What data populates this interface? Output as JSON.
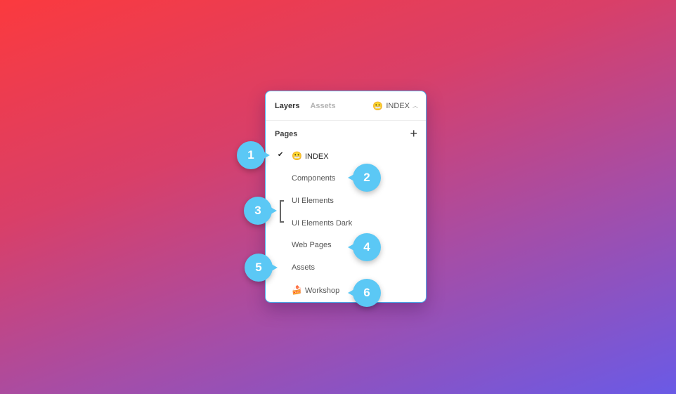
{
  "panel": {
    "tabs": [
      {
        "label": "Layers",
        "active": true
      },
      {
        "label": "Assets",
        "active": false
      }
    ],
    "current_page": {
      "emoji": "😬",
      "label": "INDEX"
    },
    "pages_header": "Pages",
    "add_icon": "plus-icon",
    "pages": [
      {
        "emoji": "😬",
        "label": "INDEX",
        "selected": true
      },
      {
        "emoji": "",
        "label": "Components"
      },
      {
        "emoji": "",
        "label": "UI Elements"
      },
      {
        "emoji": "",
        "label": "UI Elements Dark"
      },
      {
        "emoji": "",
        "label": "Web Pages"
      },
      {
        "emoji": "",
        "label": "Assets"
      },
      {
        "emoji": "🍰",
        "label": "Workshop"
      }
    ]
  },
  "annotations": [
    "1",
    "2",
    "3",
    "4",
    "5",
    "6"
  ],
  "colors": {
    "badge": "#5bc8f5",
    "panel_border": "#4ab3f0",
    "bg_top_left": "#fb3a3e",
    "bg_bottom_right": "#6a5ae6"
  }
}
